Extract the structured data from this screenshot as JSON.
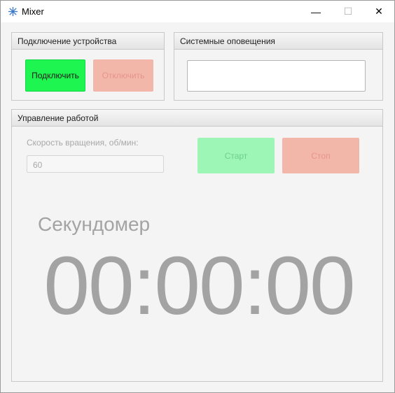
{
  "window": {
    "title": "Mixer",
    "app_icon": "snowflake-icon",
    "controls": {
      "minimize": "—",
      "maximize": "☐",
      "close": "✕"
    }
  },
  "connection": {
    "header": "Подключение устройства",
    "connect_label": "Подключить",
    "disconnect_label": "Отключить",
    "connect_color": "#1ef550",
    "disconnect_color": "#f3b7aa"
  },
  "notifications": {
    "header": "Системные оповещения",
    "text": ""
  },
  "work": {
    "header": "Управление работой",
    "speed_label": "Скорость вращения, об/мин:",
    "speed_value": "60",
    "start_label": "Старт",
    "stop_label": "Стоп",
    "start_color": "#9df5b6",
    "stop_color": "#f3b7aa"
  },
  "stopwatch": {
    "title": "Секундомер",
    "time": "00:00:00"
  }
}
